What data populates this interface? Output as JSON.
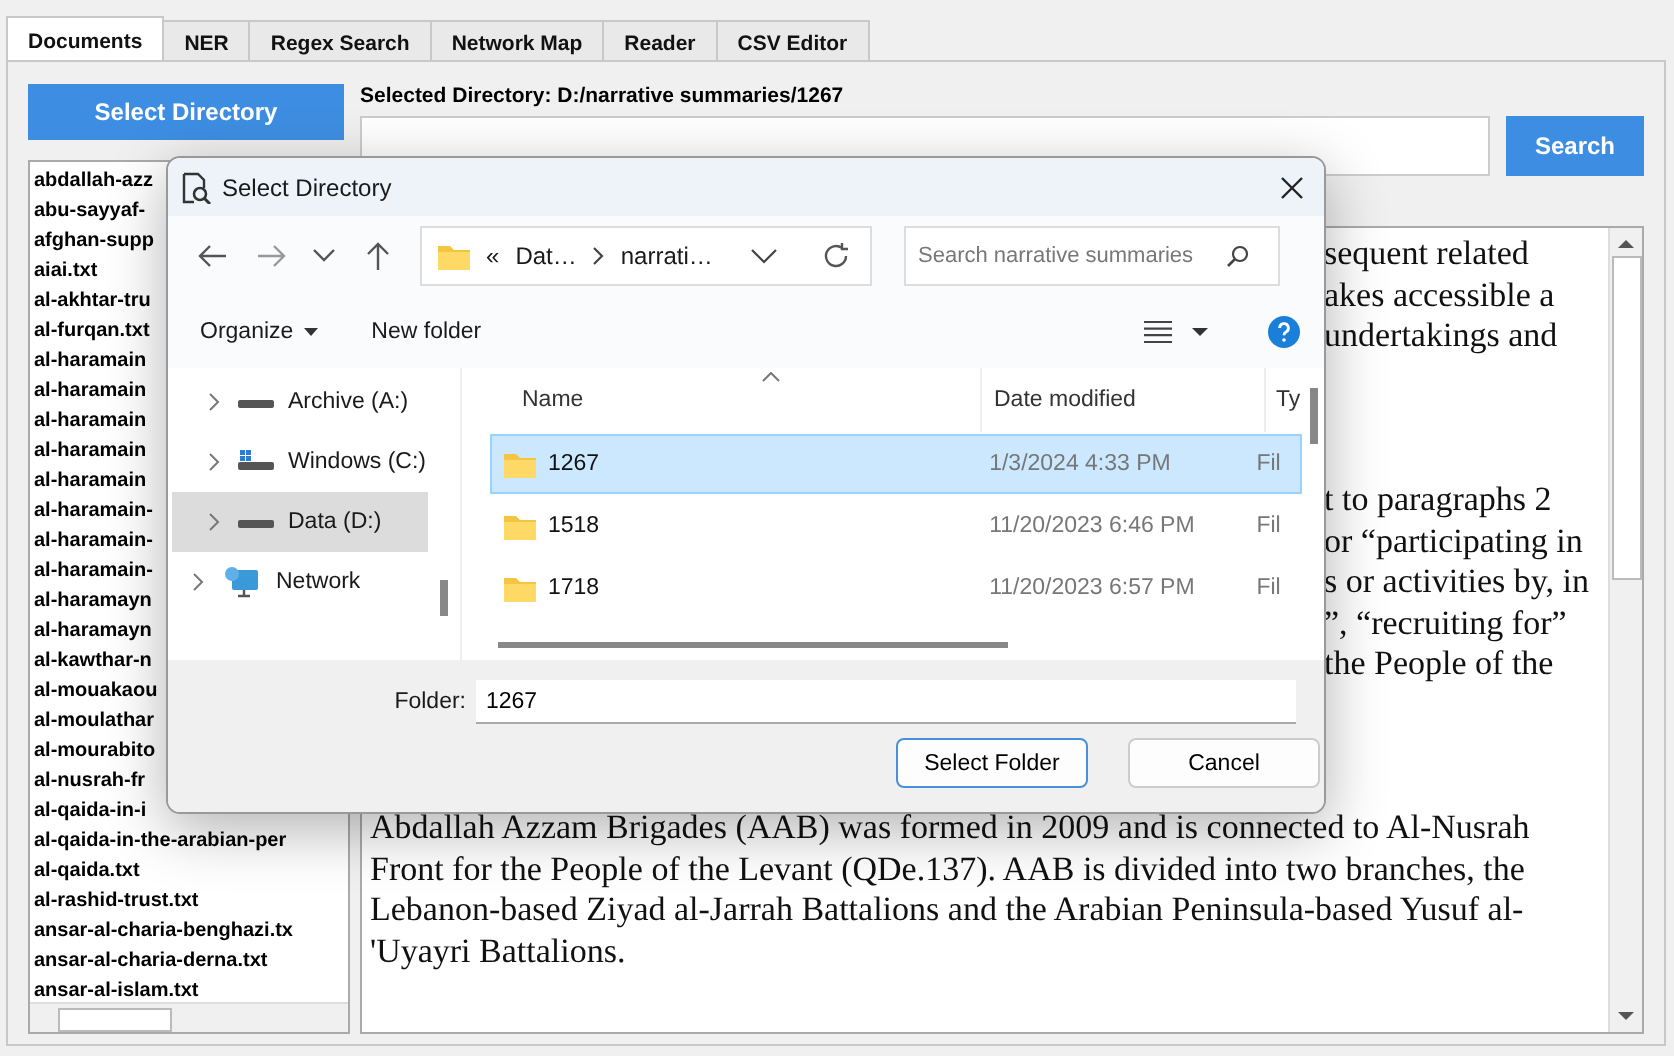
{
  "tabs": [
    {
      "label": "Documents",
      "selected": true
    },
    {
      "label": "NER",
      "selected": false
    },
    {
      "label": "Regex Search",
      "selected": false
    },
    {
      "label": "Network Map",
      "selected": false
    },
    {
      "label": "Reader",
      "selected": false
    },
    {
      "label": "CSV Editor",
      "selected": false
    }
  ],
  "select_directory_button": "Select Directory",
  "selected_directory_label": "Selected Directory: D:/narrative summaries/1267",
  "search_button": "Search",
  "file_list": [
    "abdallah-azz",
    "abu-sayyaf-",
    "afghan-supp",
    "aiai.txt",
    "al-akhtar-tru",
    "al-furqan.txt",
    "al-haramain",
    "al-haramain",
    "al-haramain",
    "al-haramain",
    "al-haramain",
    "al-haramain-",
    "al-haramain-",
    "al-haramain-",
    "al-haramayn",
    "al-haramayn",
    "al-kawthar-n",
    "al-mouakaou",
    "al-moulathar",
    "al-mourabito",
    "al-nusrah-fr",
    "al-qaida-in-i",
    "al-qaida-in-the-arabian-per",
    "al-qaida.txt",
    "al-rashid-trust.txt",
    "ansar-al-charia-benghazi.tx",
    "ansar-al-charia-derna.txt",
    "ansar-al-islam.txt"
  ],
  "reader": {
    "upper_fragments": [
      "sequent related",
      "akes accessible a",
      "undertakings and"
    ],
    "lower_fragments": [
      "t to paragraphs 2",
      "or “participating in",
      "s or activities by, in",
      "”, “recruiting for”",
      "the People of the"
    ],
    "paragraph": "Abdallah Azzam Brigades (AAB) was formed in 2009 and is connected to Al-Nusrah Front for the People of the Levant (QDe.137). AAB is divided into two branches, the Lebanon-based Ziyad al-Jarrah Battalions and the Arabian Peninsula-based Yusuf al-'Uyayri Battalions."
  },
  "dialog": {
    "title": "Select Directory",
    "address": {
      "overflow_marker": "«",
      "parts": [
        "Dat…",
        "narrati…"
      ]
    },
    "search_placeholder": "Search narrative summaries",
    "organize": "Organize",
    "new_folder": "New folder",
    "tree": [
      {
        "label": "Archive (A:)",
        "kind": "drive",
        "selected": false
      },
      {
        "label": "Windows (C:)",
        "kind": "system-drive",
        "selected": false
      },
      {
        "label": "Data (D:)",
        "kind": "drive",
        "selected": true
      },
      {
        "label": "Network",
        "kind": "network",
        "selected": false
      }
    ],
    "columns": [
      "Name",
      "Date modified",
      "Ty"
    ],
    "rows": [
      {
        "name": "1267",
        "date": "1/3/2024 4:33 PM",
        "type": "Fil",
        "selected": true
      },
      {
        "name": "1518",
        "date": "11/20/2023 6:46 PM",
        "type": "Fil",
        "selected": false
      },
      {
        "name": "1718",
        "date": "11/20/2023 6:57 PM",
        "type": "Fil",
        "selected": false
      }
    ],
    "folder_label": "Folder:",
    "folder_value": "1267",
    "buttons": [
      {
        "label": "Select Folder",
        "default": true
      },
      {
        "label": "Cancel",
        "default": false
      }
    ]
  }
}
